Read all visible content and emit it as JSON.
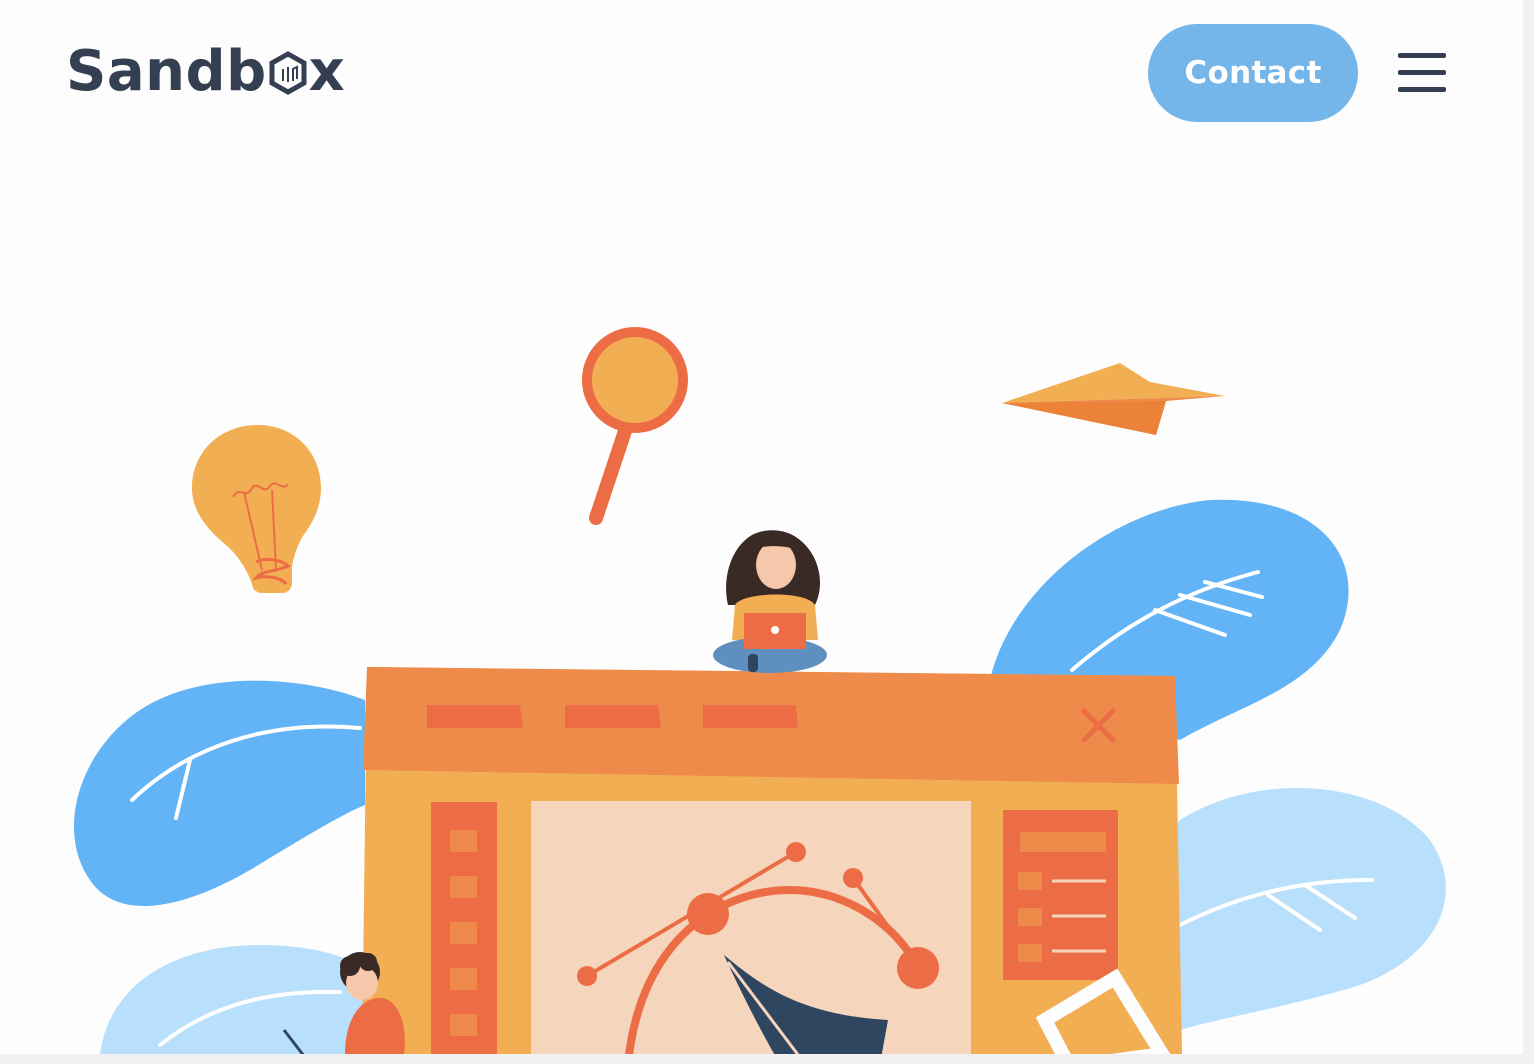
{
  "brand": {
    "logo_text_start": "Sandb",
    "logo_text_end": "x",
    "logo_color": "#343f52"
  },
  "nav": {
    "contact_label": "Contact",
    "menu_icon": "hamburger-menu-icon"
  },
  "colors": {
    "accent_blue": "#74b6ea",
    "blob_blue": "#62b4f7",
    "blob_light_blue": "#b8dffb",
    "orange": "#ef8b4a",
    "orange_dark": "#ec6d45",
    "yellow": "#f2ae52",
    "peach": "#f5d5bb",
    "navy": "#2e4660"
  },
  "illustration": {
    "elements": [
      "lightbulb-icon",
      "magnifier-icon",
      "paper-plane-icon",
      "browser-window",
      "woman-with-laptop",
      "man-drawing",
      "pen-tool-icon"
    ]
  }
}
